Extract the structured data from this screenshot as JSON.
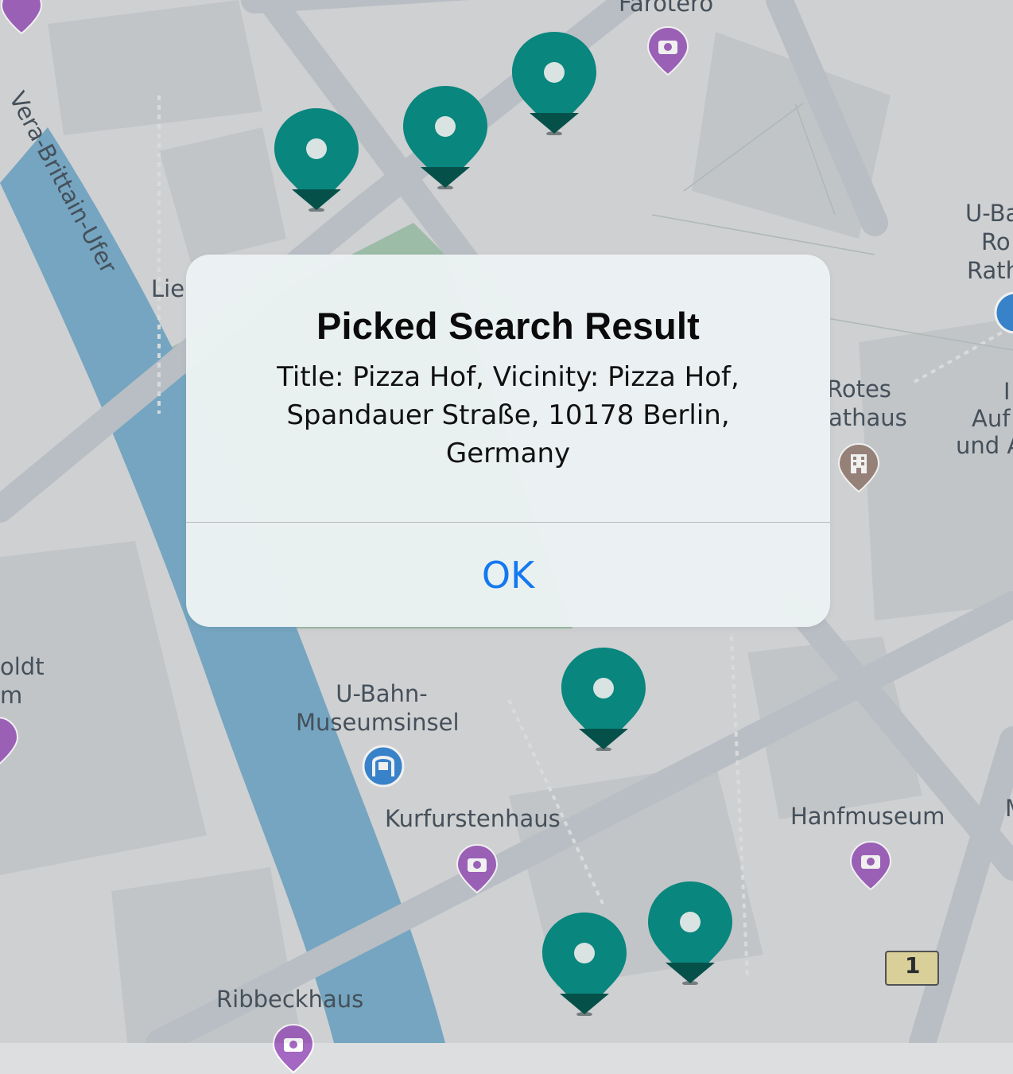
{
  "map": {
    "labels": {
      "vera": "Vera-Brittain-Ufer",
      "farotero": "Farotero",
      "lie": "Lie",
      "ubahn_rathaus_1": "U-Ba",
      "ubahn_rathaus_2": "Ro",
      "ubahn_rathaus_3": "Rath",
      "rotes_1": "Rotes",
      "rotes_2": "athaus",
      "auf_1": "I",
      "auf_2": "Auf",
      "auf_3": "und A",
      "oldt_1": "oldt",
      "oldt_2": "m",
      "museumsinsel_1": "U-Bahn-",
      "museumsinsel_2": "Museumsinsel",
      "kurfurstenhaus": "Kurfurstenhaus",
      "hanfmuseum": "Hanfmuseum",
      "ribbeckhaus": "Ribbeckhaus",
      "m_edge": "M",
      "route_shield": "1"
    },
    "pin_icon": "map-pin-icon",
    "photo_icon": "camera-icon",
    "metro_icon": "metro-icon",
    "building_icon": "building-icon",
    "colors": {
      "pin": "#0a8f86",
      "pin_dark": "#06574f",
      "poi_purple": "#a467c2",
      "poi_brown": "#a08a80",
      "water": "#7db0cc",
      "park": "#a6c8b2",
      "road": "#c9ced4",
      "ok_blue": "#1478f0"
    }
  },
  "alert": {
    "title": "Picked Search Result",
    "message": "Title: Pizza Hof, Vicinity: Pizza Hof, Spandauer Straße, 10178 Berlin, Germany",
    "ok_label": "OK"
  }
}
